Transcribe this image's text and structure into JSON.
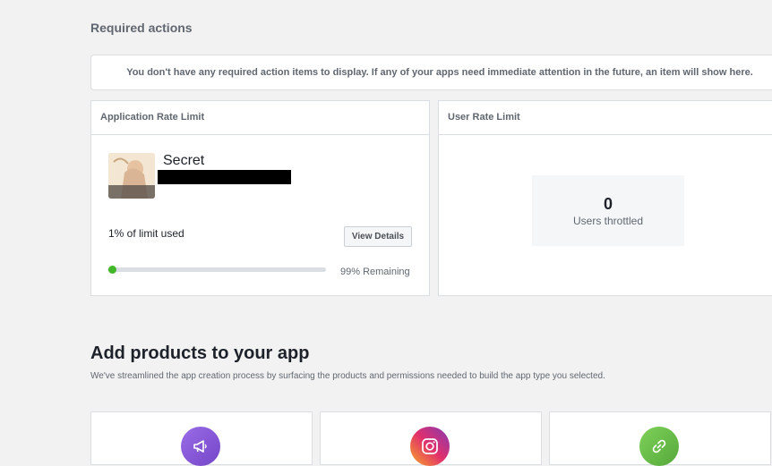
{
  "required_actions": {
    "title": "Required actions",
    "notice": "You don't have any required action items to display. If any of your apps need immediate attention in the future, an item will show here."
  },
  "app_rate_limit": {
    "title": "Application Rate Limit",
    "app_name": "Secret",
    "limit_used_text": "1% of limit used",
    "view_details_label": "View Details",
    "remaining_text": "99% Remaining",
    "used_fraction": 0.01
  },
  "user_rate_limit": {
    "title": "User Rate Limit",
    "count": "0",
    "label": "Users throttled"
  },
  "products": {
    "title": "Add products to your app",
    "subtitle": "We've streamlined the app creation process by surfacing the products and permissions needed to build the app type you selected.",
    "items": [
      {
        "icon": "megaphone-icon",
        "color": "#8a5ad8"
      },
      {
        "icon": "instagram-icon",
        "color": "#d6249f"
      },
      {
        "icon": "link-icon",
        "color": "#6ebe4a"
      }
    ]
  },
  "colors": {
    "progress": "#42b72a",
    "background": "#f2f2f2"
  }
}
